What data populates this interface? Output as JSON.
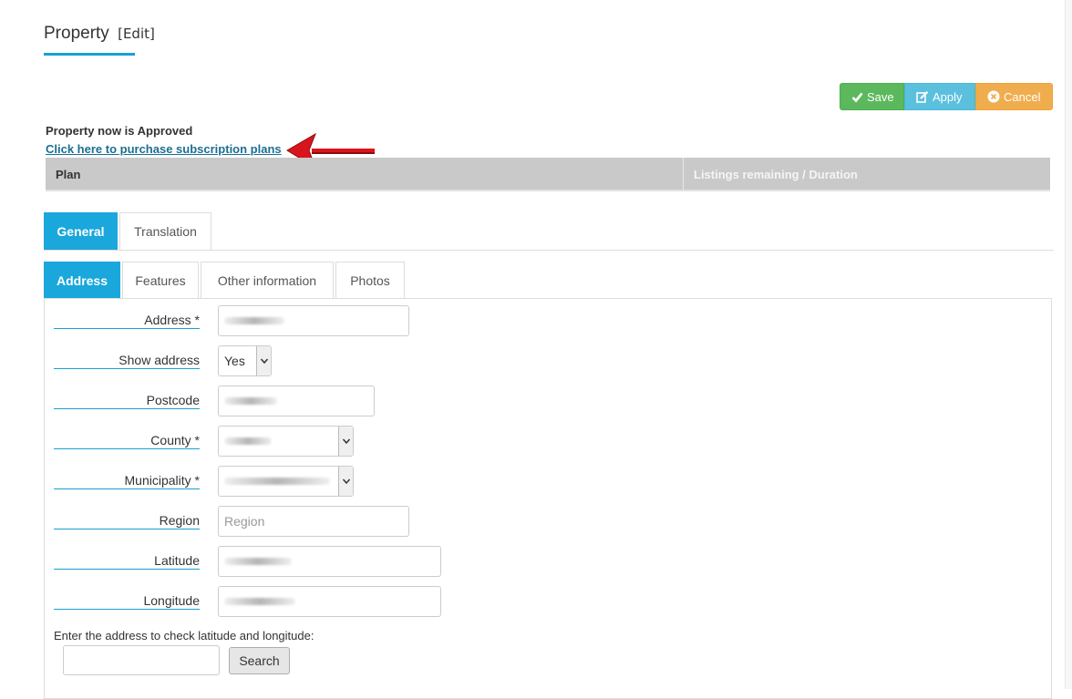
{
  "page": {
    "title": "Property",
    "subtitle": "[Edit]"
  },
  "toolbar": {
    "save_label": "Save",
    "apply_label": "Apply",
    "cancel_label": "Cancel"
  },
  "colors": {
    "accent": "#1aa7dc",
    "save": "#5cb85c",
    "apply": "#5bc0de",
    "cancel": "#f0ad4e",
    "link": "#1a6f93",
    "arrow": "#d9141c"
  },
  "status": {
    "approved_text": "Property now is Approved",
    "purchase_link": "Click here to purchase subscription plans"
  },
  "plan_table": {
    "columns": [
      "Plan",
      "Listings remaining / Duration"
    ]
  },
  "tabs_top": [
    {
      "label": "General",
      "active": true
    },
    {
      "label": "Translation",
      "active": false
    }
  ],
  "tabs_sub": [
    {
      "label": "Address",
      "active": true
    },
    {
      "label": "Features",
      "active": false
    },
    {
      "label": "Other information",
      "active": false
    },
    {
      "label": "Photos",
      "active": false
    }
  ],
  "form": {
    "address_label": "Address *",
    "show_address_label": "Show address",
    "show_address_value": "Yes",
    "postcode_label": "Postcode",
    "county_label": "County *",
    "municipality_label": "Municipality *",
    "region_label": "Region",
    "region_placeholder": "Region",
    "latitude_label": "Latitude",
    "longitude_label": "Longitude",
    "geocode_prompt": "Enter the address to check latitude and longitude:",
    "search_label": "Search"
  },
  "icons": {
    "save": "check-icon",
    "apply": "edit-icon",
    "cancel": "times-circle-icon",
    "select": "chevron-down-icon",
    "annotation": "red-arrow"
  }
}
